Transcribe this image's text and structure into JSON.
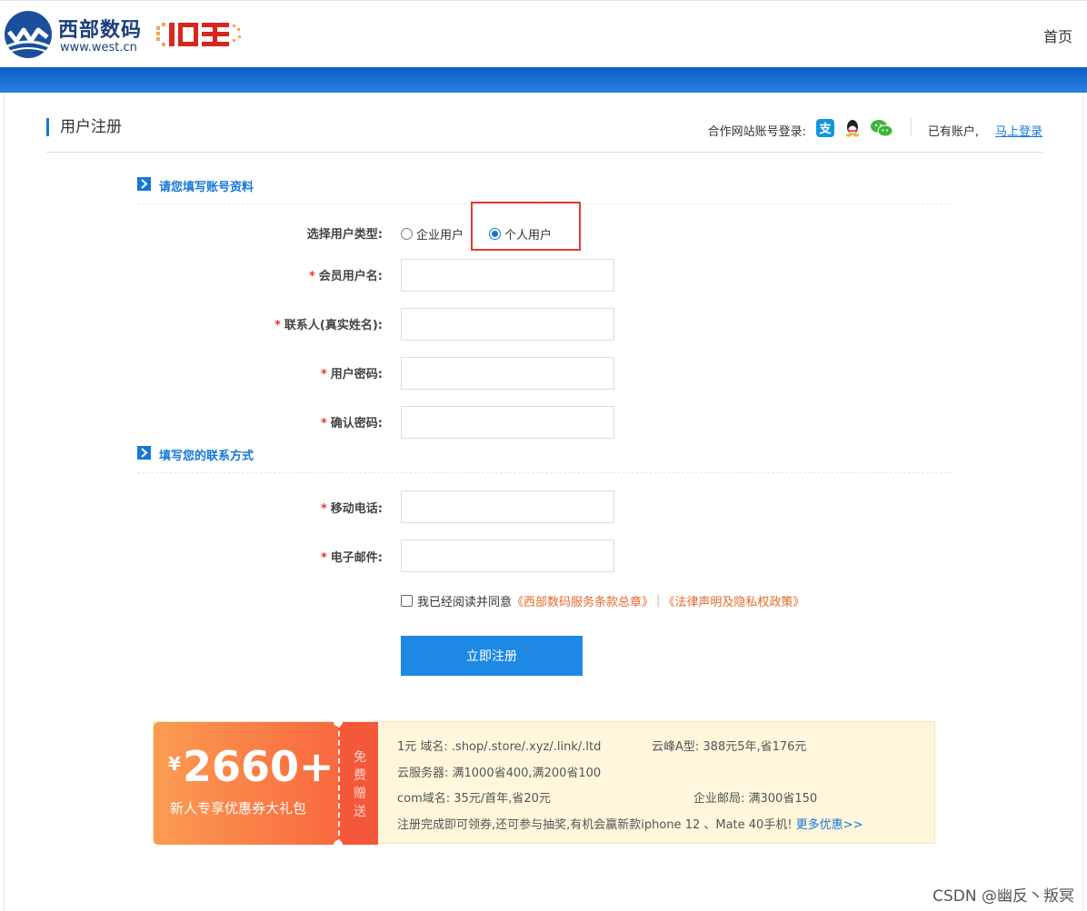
{
  "header": {
    "logo_cn": "西部数码",
    "logo_url": "www.west.cn",
    "nav_home": "首页"
  },
  "title_bar": {
    "title": "用户注册",
    "partner_label": "合作网站账号登录:",
    "partner_icons": [
      "alipay-icon",
      "qq-icon",
      "wechat-icon"
    ],
    "have_account": "已有账户,",
    "login_link": "马上登录"
  },
  "section1": {
    "title": "请您填写账号资料"
  },
  "user_type": {
    "label": "选择用户类型:",
    "options": [
      "企业用户",
      "个人用户"
    ],
    "selected": "个人用户"
  },
  "fields": {
    "username": {
      "label": "会员用户名:",
      "value": ""
    },
    "contact": {
      "label": "联系人(真实姓名):",
      "value": ""
    },
    "password": {
      "label": "用户密码:",
      "value": ""
    },
    "confirm": {
      "label": "确认密码:",
      "value": ""
    },
    "mobile": {
      "label": "移动电话:",
      "value": ""
    },
    "email": {
      "label": "电子邮件:",
      "value": ""
    }
  },
  "section2": {
    "title": "填写您的联系方式"
  },
  "agree": {
    "text": "我已经阅读并同意",
    "terms1": "《西部数码服务条款总章》",
    "sep": "|",
    "terms2": "《法律声明及隐私权政策》",
    "checked": false
  },
  "submit_label": "立即注册",
  "promo": {
    "yen": "¥",
    "amount": "2660+",
    "sub": "新人专享优惠券大礼包",
    "tag": [
      "免",
      "费",
      "赠",
      "送"
    ],
    "line1a": "1元 域名: .shop/.store/.xyz/.link/.ltd",
    "line1b": "云峰A型: 388元5年,省176元",
    "line2": "云服务器: 满1000省400,满200省100",
    "line3a": "com域名: 35元/首年,省20元",
    "line3b": "企业邮局: 满300省150",
    "line4": "注册完成即可领券,还可参与抽奖,有机会赢新款iphone 12 、Mate 40手机!",
    "more": "更多优惠>>"
  },
  "colors": {
    "accent": "#1677d9",
    "band": "#0e5ec7",
    "required": "#e33333",
    "terms": "#e8682a",
    "highlight": "#e53935",
    "promo_bg": "#fff6dc"
  },
  "watermark": "CSDN @幽反丶叛冥"
}
